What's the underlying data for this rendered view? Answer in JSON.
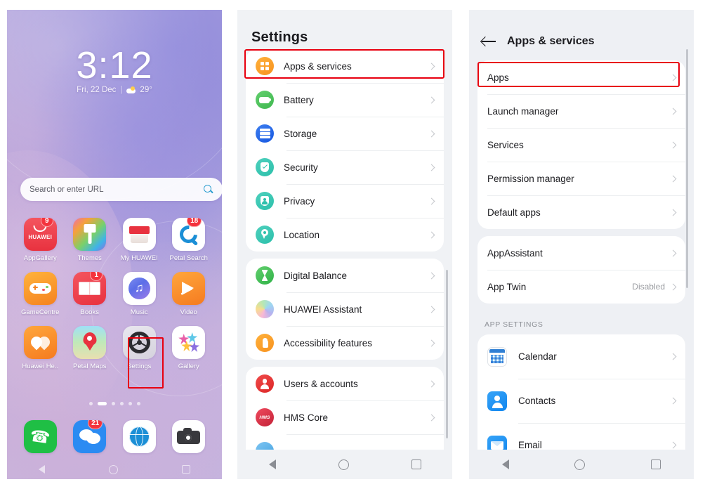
{
  "home": {
    "clock": "3:12",
    "date": "Fri, 22 Dec",
    "separator": "|",
    "temperature": "29°",
    "search_placeholder": "Search or enter URL",
    "apps": [
      {
        "label": "AppGallery",
        "icon": "appgallery-icon",
        "badge": "9"
      },
      {
        "label": "Themes",
        "icon": "themes-icon",
        "badge": ""
      },
      {
        "label": "My HUAWEI",
        "icon": "my-huawei-icon",
        "badge": ""
      },
      {
        "label": "Petal Search",
        "icon": "petal-search-icon",
        "badge": "18"
      },
      {
        "label": "GameCentre",
        "icon": "game-centre-icon",
        "badge": ""
      },
      {
        "label": "Books",
        "icon": "books-icon",
        "badge": "1"
      },
      {
        "label": "Music",
        "icon": "music-icon",
        "badge": ""
      },
      {
        "label": "Video",
        "icon": "video-icon",
        "badge": ""
      },
      {
        "label": "Huawei He..",
        "icon": "huawei-health-icon",
        "badge": ""
      },
      {
        "label": "Petal Maps",
        "icon": "petal-maps-icon",
        "badge": ""
      },
      {
        "label": "Settings",
        "icon": "settings-gear-icon",
        "badge": ""
      },
      {
        "label": "Gallery",
        "icon": "gallery-icon",
        "badge": ""
      }
    ],
    "page_count": 6,
    "page_active_index": 1,
    "dock": [
      {
        "label": "Phone",
        "icon": "phone-icon",
        "badge": ""
      },
      {
        "label": "Messages",
        "icon": "message-icon",
        "badge": "21"
      },
      {
        "label": "Browser",
        "icon": "browser-icon",
        "badge": ""
      },
      {
        "label": "Camera",
        "icon": "camera-icon",
        "badge": ""
      }
    ]
  },
  "settings": {
    "title": "Settings",
    "groups": [
      {
        "items": [
          {
            "label": "Apps & services",
            "icon": "apps-services-icon",
            "value": ""
          },
          {
            "label": "Battery",
            "icon": "battery-icon",
            "value": ""
          },
          {
            "label": "Storage",
            "icon": "storage-icon",
            "value": ""
          },
          {
            "label": "Security",
            "icon": "security-shield-icon",
            "value": ""
          },
          {
            "label": "Privacy",
            "icon": "privacy-icon",
            "value": ""
          },
          {
            "label": "Location",
            "icon": "location-pin-icon",
            "value": ""
          }
        ]
      },
      {
        "items": [
          {
            "label": "Digital Balance",
            "icon": "digital-balance-icon",
            "value": ""
          },
          {
            "label": "HUAWEI Assistant",
            "icon": "huawei-assistant-icon",
            "value": ""
          },
          {
            "label": "Accessibility features",
            "icon": "accessibility-icon",
            "value": ""
          }
        ]
      },
      {
        "items": [
          {
            "label": "Users & accounts",
            "icon": "users-accounts-icon",
            "value": ""
          },
          {
            "label": "HMS Core",
            "icon": "hms-core-icon",
            "value": ""
          }
        ]
      }
    ],
    "highlighted_item": "Apps & services"
  },
  "apps_services": {
    "title": "Apps & services",
    "back_icon": "back-arrow-icon",
    "groups": [
      {
        "items": [
          {
            "label": "Apps",
            "value": ""
          },
          {
            "label": "Launch manager",
            "value": ""
          },
          {
            "label": "Services",
            "value": ""
          },
          {
            "label": "Permission manager",
            "value": ""
          },
          {
            "label": "Default apps",
            "value": ""
          }
        ]
      },
      {
        "items": [
          {
            "label": "AppAssistant",
            "value": ""
          },
          {
            "label": "App Twin",
            "value": "Disabled"
          }
        ]
      }
    ],
    "app_settings_header": "APP SETTINGS",
    "app_settings": [
      {
        "label": "Calendar",
        "icon": "calendar-icon"
      },
      {
        "label": "Contacts",
        "icon": "contacts-icon"
      },
      {
        "label": "Email",
        "icon": "email-icon"
      }
    ],
    "highlighted_item": "Apps"
  },
  "navbar": {
    "back": "back-triangle-icon",
    "home": "home-circle-icon",
    "recents": "recents-square-icon"
  },
  "colors": {
    "highlight": "#e8000f",
    "accent_orange": "#f7921e",
    "accent_blue": "#1186ef",
    "badge_red": "#f4333d"
  }
}
